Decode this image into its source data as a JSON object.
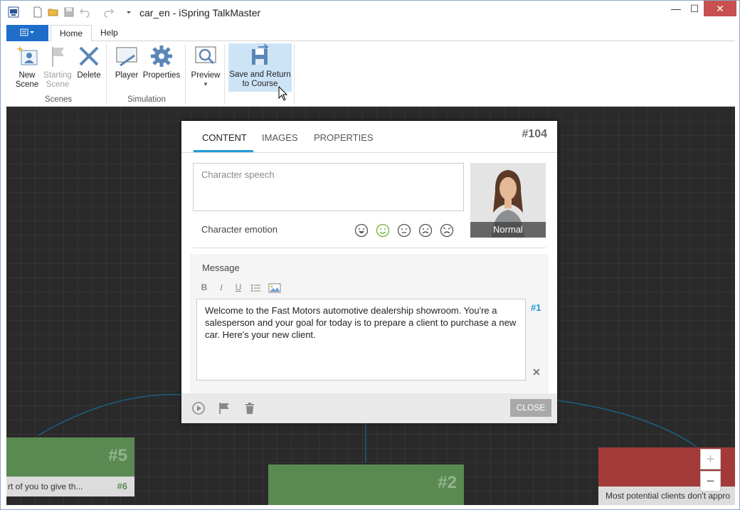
{
  "window": {
    "title": "car_en - iSpring TalkMaster",
    "minimize": "—",
    "maximize": "☐",
    "close": "✕"
  },
  "ribbon": {
    "tabs": [
      {
        "label": "Home"
      },
      {
        "label": "Help"
      }
    ],
    "buttons": {
      "new_scene": "New\nScene",
      "starting_scene": "Starting\nScene",
      "delete": "Delete",
      "player": "Player",
      "properties": "Properties",
      "preview": "Preview",
      "save_return": "Save and Return\nto Course"
    },
    "groups": {
      "scenes": "Scenes",
      "simulation": "Simulation"
    }
  },
  "dialog": {
    "tabs": {
      "content": "CONTENT",
      "images": "IMAGES",
      "properties": "PROPERTIES"
    },
    "scene_id": "#104",
    "speech_placeholder": "Character speech",
    "emotion_label": "Character emotion",
    "selected_emotion_index": 1,
    "character_caption": "Normal",
    "message_label": "Message",
    "format_buttons": [
      "B",
      "I",
      "U"
    ],
    "message_text": "Welcome to the Fast Motors automotive dealership showroom. You're a salesperson and your goal for today is to prepare a client to purchase a new car. Here's your new client.",
    "message_number": "#1",
    "close_button": "CLOSE"
  },
  "canvas": {
    "nodes": [
      {
        "id": "#5",
        "sub_text": "rt of you to give th...",
        "sub_id": "#6",
        "color": "#5a8a52"
      },
      {
        "id": "#2",
        "color": "#5a8a52"
      },
      {
        "text": "Most potential clients don't appro",
        "color": "#a23a3a"
      }
    ],
    "zoom_in": "+",
    "zoom_out": "−"
  },
  "colors": {
    "accent": "#1f9bd6",
    "file_tab": "#1e6ec9",
    "highlight": "#cde4f7",
    "green_node": "#5a8a52",
    "red_node": "#a23a3a"
  }
}
